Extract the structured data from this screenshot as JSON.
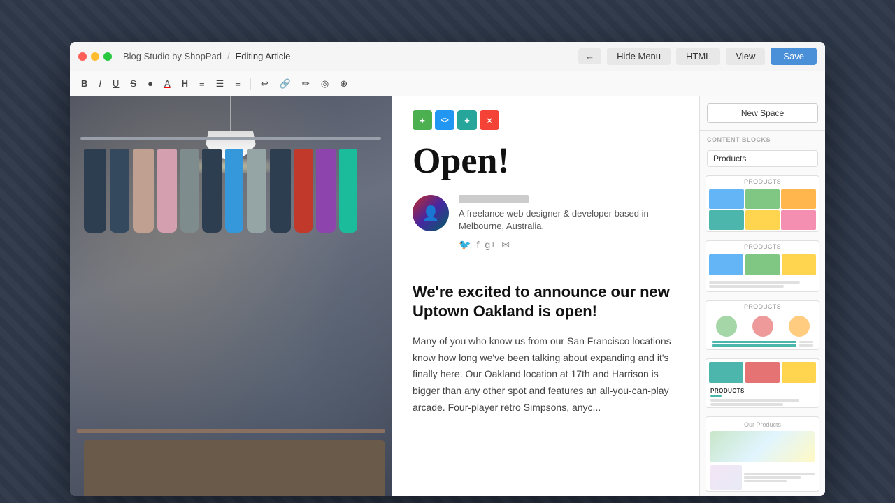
{
  "app": {
    "title": "Blog Studio by ShopPad",
    "breadcrumb_sep": "/",
    "editing_label": "Editing Article"
  },
  "titlebar": {
    "back_btn": "←",
    "hide_menu_btn": "Hide Menu",
    "html_btn": "HTML",
    "view_btn": "View",
    "save_btn": "Save"
  },
  "toolbar": {
    "buttons": [
      "B",
      "I",
      "U",
      "S",
      "•",
      "A",
      "A",
      "H",
      "≡",
      "≡",
      "↩",
      "🖊",
      "◉"
    ]
  },
  "editor": {
    "float_buttons": [
      "+",
      "<>",
      "+",
      "×"
    ],
    "article_title": "Open!",
    "author_bio": "A freelance web designer & developer based in Melbourne, Australia.",
    "article_heading": "We're excited to announce our new Uptown Oakland is open!",
    "article_body": "Many of you who know us from our San Francisco locations know how long we've been talking about expanding and it's finally here. Our Oakland location at 17th and Harrison is bigger than any other spot and features an all-you-can-play arcade. Four-player retro Simpsons, anyc..."
  },
  "sidebar": {
    "new_space_label": "New Space",
    "content_blocks_label": "CONTENT BLOCKS",
    "products_dropdown": "Products",
    "blocks": [
      {
        "id": "block1",
        "label": "PRODUCTS"
      },
      {
        "id": "block2",
        "label": "Products"
      },
      {
        "id": "block3",
        "label": "Products"
      },
      {
        "id": "block4",
        "label": "PRODUCTS"
      },
      {
        "id": "block5",
        "label": "Our Products"
      }
    ]
  }
}
